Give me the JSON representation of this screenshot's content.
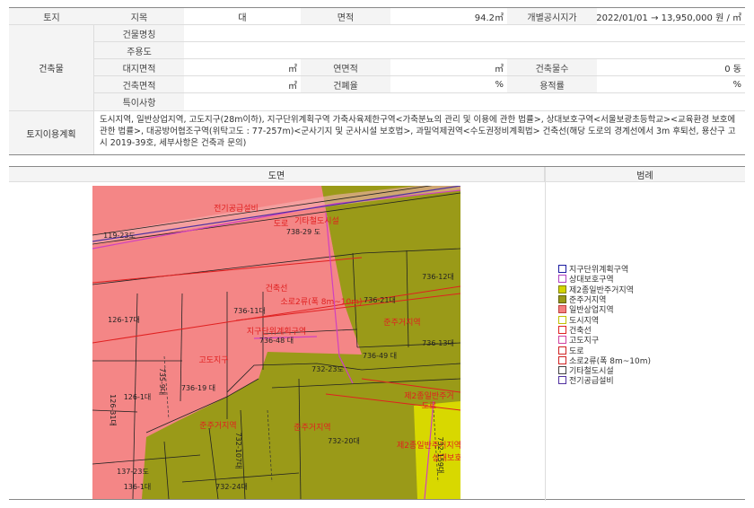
{
  "land": {
    "label": "토지",
    "jimok_label": "지목",
    "jimok_value": "대",
    "area_label": "면적",
    "area_value": "94.2㎡",
    "price_label": "개별공시지가",
    "price_value": "2022/01/01 → 13,950,000 원 / ㎡"
  },
  "building": {
    "label": "건축물",
    "name_label": "건물명칭",
    "use_label": "주용도",
    "site_area_label": "대지면적",
    "site_area_unit": "㎡",
    "floor_area_label": "연면적",
    "floor_area_unit": "㎡",
    "floors_label": "건축물수",
    "floors_value": "0 동",
    "build_area_label": "건축면적",
    "build_area_unit": "㎡",
    "coverage_label": "건폐율",
    "coverage_unit": "%",
    "far_label": "용적률",
    "far_unit": "%",
    "special_label": "특이사항"
  },
  "landuse": {
    "label": "토지이용계획",
    "text": "도시지역, 일반상업지역, 고도지구(28m이하), 지구단위계획구역 가축사육제한구역<가축분뇨의 관리 및 이용에 관한 법률>, 상대보호구역<서울보광초등학교><교육환경 보호에 관한 법률>, 대공방어협조구역(위탁고도 : 77-257m)<군사기지 및 군사시설 보호법>, 과밀억제권역<수도권정비계획법> 건축선(해당 도로의 경계선에서 3m 후퇴선, 용산구 고시 2019-39호, 세부사항은 건축과 문의)"
  },
  "map": {
    "header_map": "도면",
    "header_legend": "범례",
    "labels": {
      "l1": "전기공급설비",
      "l2": "도로",
      "l3": "기타철도시설",
      "l4": "738-29 도",
      "l5": "119-23도",
      "l6": "736-12대",
      "l7": "건축선",
      "l8": "소로2류(폭 8m~10m)",
      "l9": "736-21대",
      "l10": "126-17대",
      "l11": "736-11대",
      "l12": "준주거지역",
      "l13": "지구단위계획구역",
      "l14": "736-48 대",
      "l15": "736-13대",
      "l16": "736-49 대",
      "l17": "고도지구",
      "l18": "732-23도",
      "l19": "735-9대",
      "l20": "126-31대",
      "l21": "126-1대",
      "l22": "736-19 대",
      "l23": "제2종일반주거",
      "l24": "도로",
      "l25": "준주거지역",
      "l26": "준주거지역",
      "l27": "732-107대",
      "l28": "732-20대",
      "l29": "제2종일반주거지역",
      "l30": "137-23도",
      "l31": "136-1대",
      "l32": "732-24대",
      "l33": "732-159대",
      "l34": "상대보호"
    },
    "legend": [
      {
        "label": "지구단위계획구역",
        "fill": "#ffffff",
        "border": "#1a1aa0"
      },
      {
        "label": "상대보호구역",
        "fill": "#ffffff",
        "border": "#b040c0"
      },
      {
        "label": "제2종일반주거지역",
        "fill": "#d4d400",
        "border": "#808000"
      },
      {
        "label": "준주거지역",
        "fill": "#9a9a18",
        "border": "#606010"
      },
      {
        "label": "일반상업지역",
        "fill": "#f48080",
        "border": "#c04040"
      },
      {
        "label": "도시지역",
        "fill": "#ffffff",
        "border": "#c0c000"
      },
      {
        "label": "건축선",
        "fill": "#ffffff",
        "border": "#e02020"
      },
      {
        "label": "고도지구",
        "fill": "#ffffff",
        "border": "#d040a0"
      },
      {
        "label": "도로",
        "fill": "#ffffff",
        "border": "#d02020"
      },
      {
        "label": "소로2류(폭 8m~10m)",
        "fill": "#ffffff",
        "border": "#d02020"
      },
      {
        "label": "기타철도시설",
        "fill": "#ffffff",
        "border": "#404040"
      },
      {
        "label": "전기공급설비",
        "fill": "#ffffff",
        "border": "#5030a0"
      }
    ]
  }
}
